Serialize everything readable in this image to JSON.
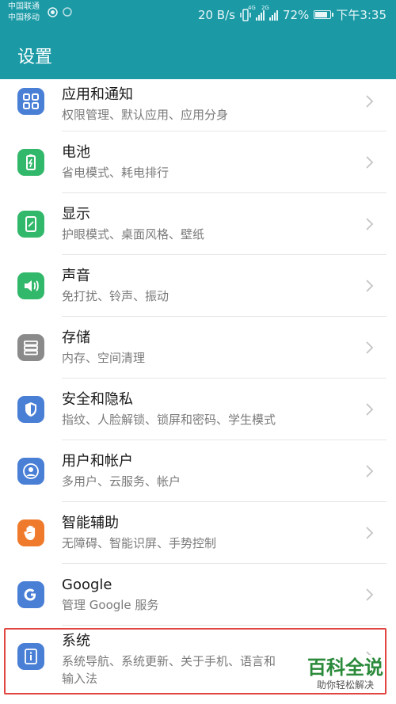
{
  "status_bar": {
    "carrier_1": "中国联通",
    "carrier_2": "中国移动",
    "speed": "20 B/s",
    "network_tag_1": "4G",
    "network_tag_2": "2G",
    "battery": "72%",
    "battery_level": 0.72,
    "time": "下午3:35"
  },
  "app_bar": {
    "title": "设置"
  },
  "settings": [
    {
      "title": "应用和通知",
      "subtitle": "权限管理、默认应用、应用分身",
      "icon": "apps-grid-icon",
      "color": "#4a7fd6"
    },
    {
      "title": "电池",
      "subtitle": "省电模式、耗电排行",
      "icon": "battery-icon",
      "color": "#32b86a"
    },
    {
      "title": "显示",
      "subtitle": "护眼模式、桌面风格、壁纸",
      "icon": "display-icon",
      "color": "#32b86a"
    },
    {
      "title": "声音",
      "subtitle": "免打扰、铃声、振动",
      "icon": "speaker-icon",
      "color": "#32b86a"
    },
    {
      "title": "存储",
      "subtitle": "内存、空间清理",
      "icon": "storage-icon",
      "color": "#8a8a8a"
    },
    {
      "title": "安全和隐私",
      "subtitle": "指纹、人脸解锁、锁屏和密码、学生模式",
      "icon": "shield-icon",
      "color": "#4a7fd6"
    },
    {
      "title": "用户和帐户",
      "subtitle": "多用户、云服务、帐户",
      "icon": "user-icon",
      "color": "#4a7fd6"
    },
    {
      "title": "智能辅助",
      "subtitle": "无障碍、智能识屏、手势控制",
      "icon": "hand-icon",
      "color": "#f07a2c"
    },
    {
      "title": "Google",
      "subtitle": "管理 Google 服务",
      "icon": "google-icon",
      "color": "#4a7fd6"
    },
    {
      "title": "系统",
      "subtitle": "系统导航、系统更新、关于手机、语言和",
      "subtitle_2": "输入法",
      "icon": "info-icon",
      "color": "#4a7fd6"
    }
  ],
  "watermark": {
    "title": "百科全说",
    "tagline": "助你轻松解决"
  }
}
